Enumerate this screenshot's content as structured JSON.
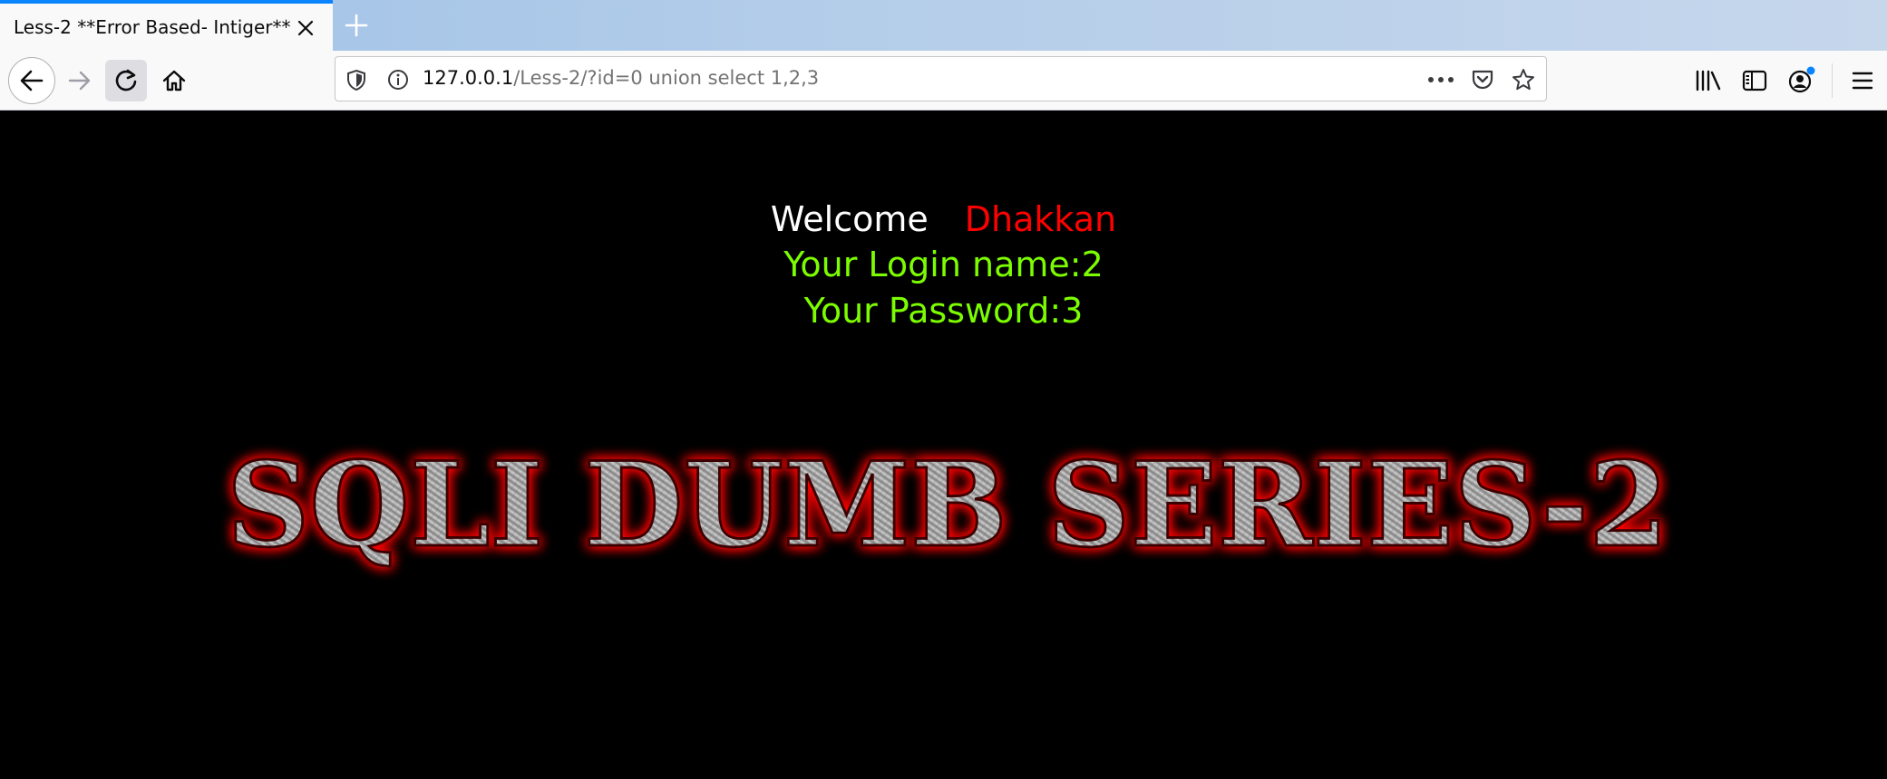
{
  "browser": {
    "tab": {
      "title": "Less-2 **Error Based- Intiger**"
    },
    "url": {
      "host": "127.0.0.1",
      "path": "/Less-2/?id=0 union select 1,2,3"
    }
  },
  "page": {
    "welcome_word": "Welcome",
    "welcome_name": "Dhakkan",
    "login_line": "Your Login name:2",
    "password_line": "Your Password:3",
    "banner_text": "SQLI DUMB SERIES-2"
  },
  "icons": {
    "accent": "#0a84ff",
    "welcome_color": "#ffffff",
    "name_color": "#ff0000",
    "result_color": "#7cfc00",
    "banner_glow": "#ff0000"
  }
}
